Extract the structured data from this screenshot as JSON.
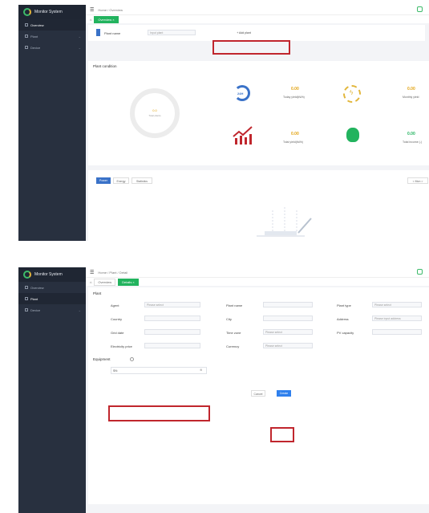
{
  "app": {
    "title": "Monitor System"
  },
  "sidebar": {
    "items": [
      {
        "label": "Overview"
      },
      {
        "label": "Plant"
      },
      {
        "label": "Device"
      }
    ]
  },
  "screen1": {
    "breadcrumb": "Home / Overview",
    "tabs": [
      {
        "label": "Overview ×"
      }
    ],
    "plant_name_label": "Plant name",
    "plant_name_placeholder": "Input plant",
    "add_plant_button": "+ Add plant",
    "plant_condition_title": "Plant condition",
    "ring_value": "0.0",
    "ring_label": "Total plants",
    "stats": [
      {
        "value": "0.00",
        "label": "Today yield(kWh)"
      },
      {
        "value": "0.00",
        "label": "Monthly yield"
      },
      {
        "value": "0.00",
        "label": "Total yield(kWh)"
      },
      {
        "value": "0.00",
        "label": "Total income (-)"
      }
    ],
    "bottom_tabs": [
      {
        "label": "Power"
      },
      {
        "label": "Energy"
      },
      {
        "label": "Statistics"
      }
    ],
    "right_button": "< Mon >",
    "colors": {
      "accent": "#22b35e",
      "value": "#e2a312",
      "highlight": "#c0262d"
    }
  },
  "screen2": {
    "breadcrumb": "Home / Plant / Detail",
    "tabs": [
      {
        "label": "Overview"
      },
      {
        "label": "Details ×"
      }
    ],
    "plant_section": "Plant",
    "fields": [
      {
        "label": "Agent",
        "value": "Please select"
      },
      {
        "label": "Plant name",
        "value": ""
      },
      {
        "label": "Plant type",
        "value": "Please select"
      },
      {
        "label": "Country",
        "value": ""
      },
      {
        "label": "City",
        "value": ""
      },
      {
        "label": "Address",
        "value": "Please input address"
      },
      {
        "label": "Grid date",
        "value": ""
      },
      {
        "label": "Time zone",
        "value": "Please select"
      },
      {
        "label": "PV capacity",
        "value": ""
      },
      {
        "label": "Electricity price",
        "value": ""
      },
      {
        "label": "Currency",
        "value": "Please select"
      }
    ],
    "equipment_section": "Equipment",
    "equipment_value": "SN:",
    "cancel_button": "Cancel",
    "create_button": "Create"
  }
}
